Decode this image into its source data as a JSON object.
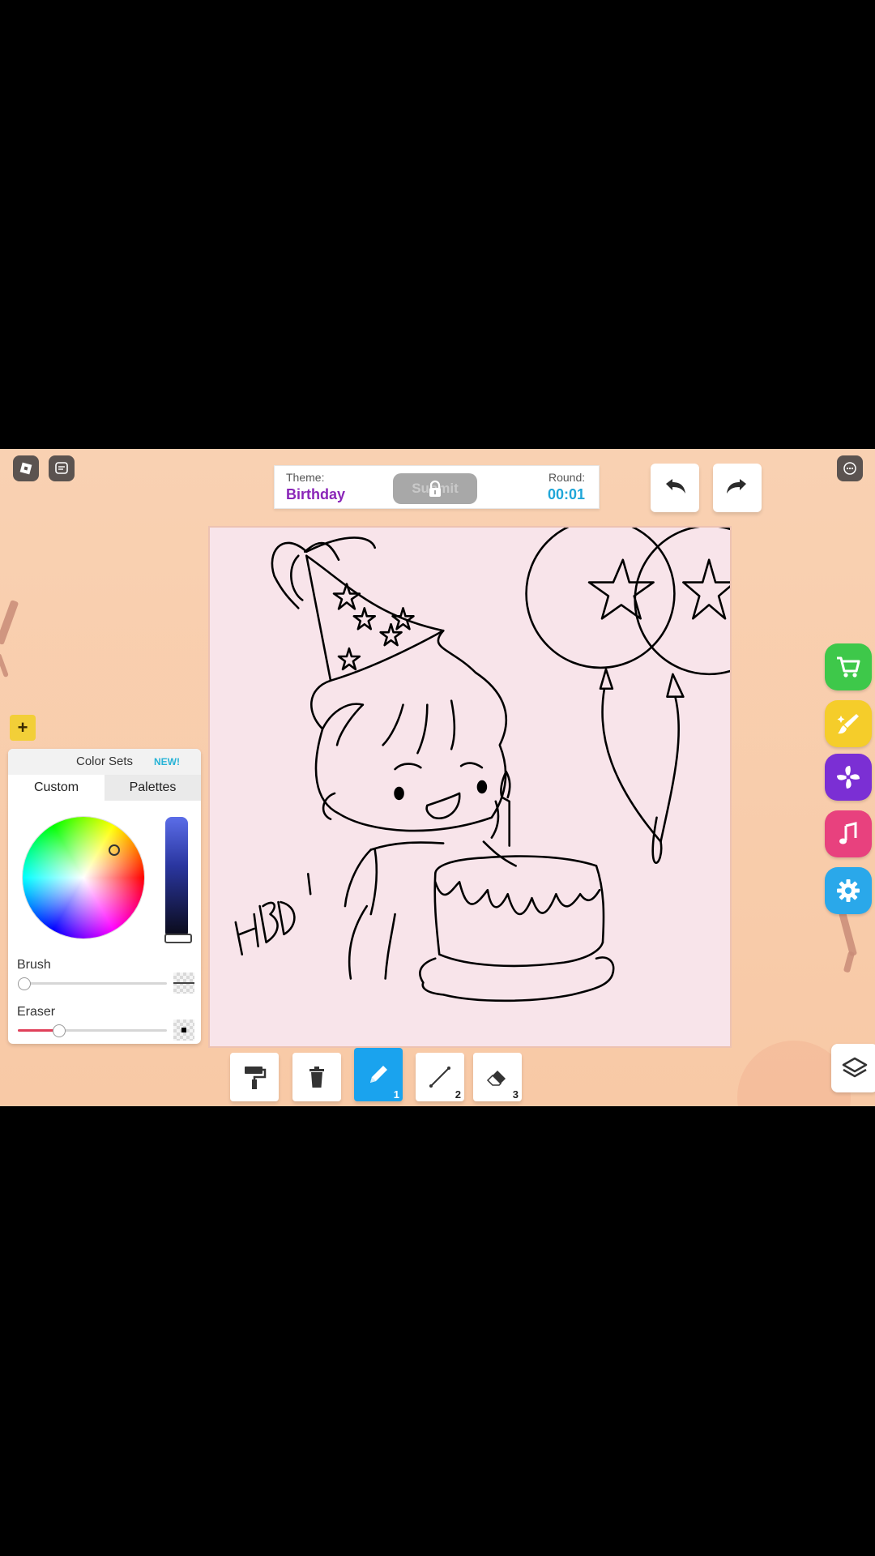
{
  "header": {
    "theme_label": "Theme:",
    "theme_value": "Birthday",
    "submit_label": "Submit",
    "round_label": "Round:",
    "round_value": "00:01"
  },
  "color_panel": {
    "title": "Color Sets",
    "new_badge": "NEW!",
    "tabs": [
      {
        "label": "Custom",
        "active": true
      },
      {
        "label": "Palettes",
        "active": false
      }
    ],
    "brush_label": "Brush",
    "eraser_label": "Eraser",
    "brush_size_fraction": 0.0,
    "eraser_size_fraction": 0.25,
    "selected_color": "#2a36a0"
  },
  "add_button_label": "+",
  "tools": [
    {
      "name": "paint-roller",
      "number": ""
    },
    {
      "name": "trash",
      "number": ""
    },
    {
      "name": "pencil",
      "number": "1",
      "active": true
    },
    {
      "name": "line",
      "number": "2"
    },
    {
      "name": "eraser",
      "number": "3"
    }
  ],
  "side_buttons": [
    {
      "name": "shop",
      "color": "#3ec84a"
    },
    {
      "name": "brush-style",
      "color": "#f5cd2a"
    },
    {
      "name": "pinwheel",
      "color": "#7b2fd4"
    },
    {
      "name": "music",
      "color": "#e8417e"
    },
    {
      "name": "settings",
      "color": "#2aa8ea"
    }
  ],
  "colors": {
    "theme_value": "#8a25b8",
    "round_value": "#1fa6d8",
    "active_tool": "#1aa3ee"
  }
}
